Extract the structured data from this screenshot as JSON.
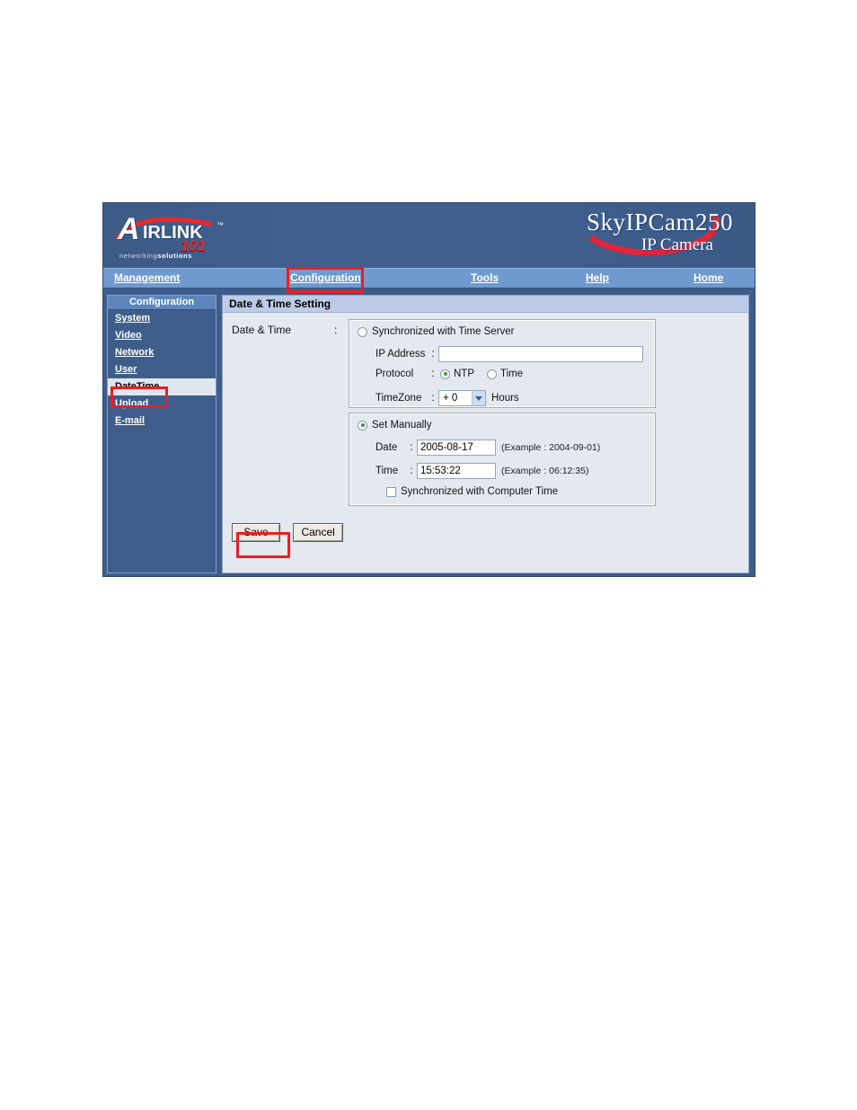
{
  "brand": {
    "logo_letter": "A",
    "logo_word": "IRLINK",
    "logo_tm": "™",
    "logo_number": "101",
    "logo_tagline_light": "networking",
    "logo_tagline_bold": "solutions",
    "product_name": "SkyIPCam250",
    "product_sub": "IP Camera"
  },
  "nav": {
    "management": "Management",
    "configuration": "Configuration",
    "tools": "Tools",
    "help": "Help",
    "home": "Home"
  },
  "sidebar": {
    "title": "Configuration",
    "items": [
      {
        "label": "System",
        "active": false
      },
      {
        "label": "Video",
        "active": false
      },
      {
        "label": "Network",
        "active": false
      },
      {
        "label": "User",
        "active": false
      },
      {
        "label": "DateTime",
        "active": true
      },
      {
        "label": "Upload",
        "active": false
      },
      {
        "label": "E-mail",
        "active": false
      }
    ]
  },
  "content": {
    "title": "Date & Time Setting",
    "row_label": "Date & Time",
    "colon": ":",
    "time_server": {
      "option_label": "Synchronized with Time Server",
      "option_checked": false,
      "ip_label": "IP Address",
      "ip_colon": ":",
      "ip_value": "",
      "protocol_label": "Protocol",
      "protocol_colon": ":",
      "protocol_ntp": "NTP",
      "protocol_ntp_checked": true,
      "protocol_time": "Time",
      "protocol_time_checked": false,
      "timezone_label": "TimeZone",
      "timezone_colon": ":",
      "timezone_value": "+ 0",
      "timezone_unit": "Hours"
    },
    "manual": {
      "option_label": "Set Manually",
      "option_checked": true,
      "date_label": "Date",
      "date_colon": ":",
      "date_value": "2005-08-17",
      "date_hint": "(Example : 2004-09-01)",
      "time_label": "Time",
      "time_colon": ":",
      "time_value": "15:53:22",
      "time_hint": "(Example : 06:12:35)",
      "sync_computer_label": "Synchronized with Computer Time",
      "sync_computer_checked": false
    },
    "buttons": {
      "save": "Save",
      "cancel": "Cancel"
    }
  },
  "annotations": {
    "highlight_color": "#ee1c22",
    "boxes": [
      "configuration-nav",
      "datetime-sidebar-item",
      "save-button"
    ]
  }
}
